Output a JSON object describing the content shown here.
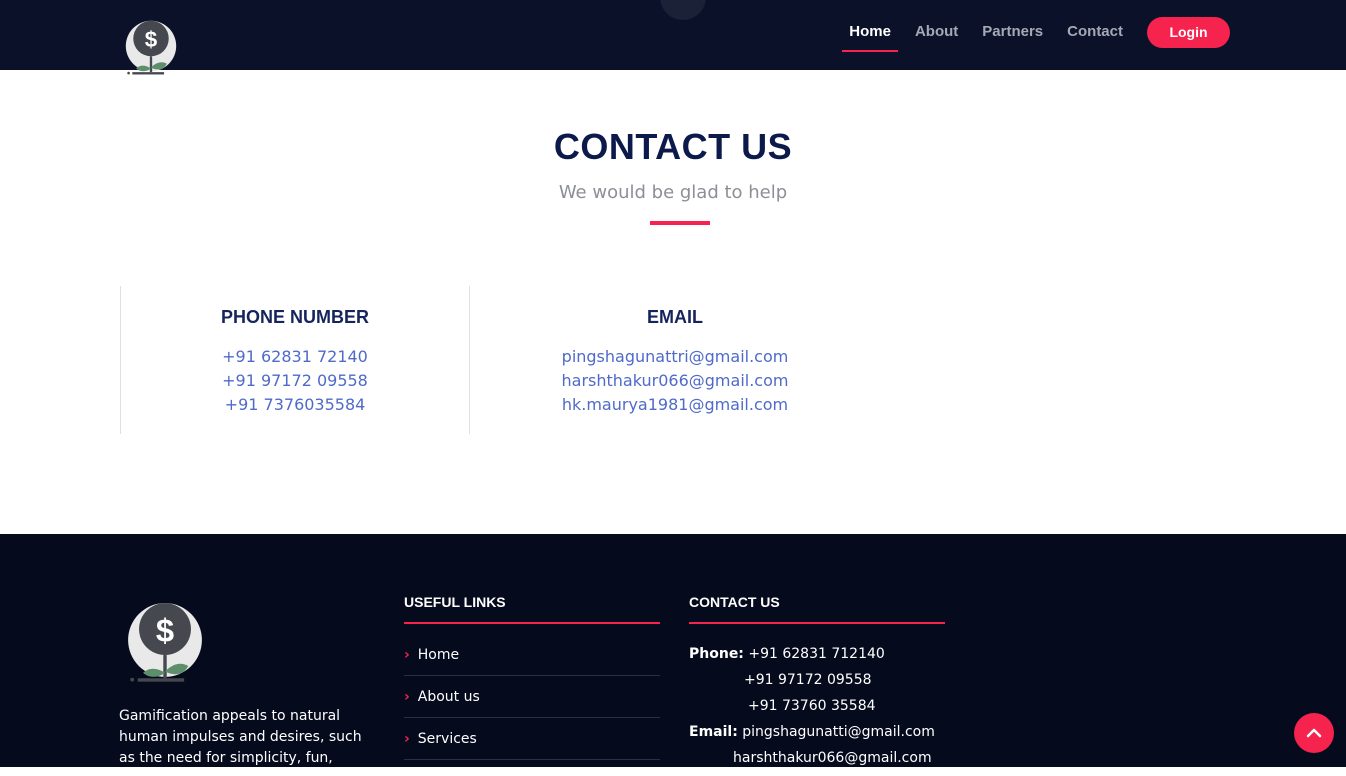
{
  "header": {
    "nav": [
      "Home",
      "About",
      "Partners",
      "Contact"
    ],
    "active_nav": "Home",
    "login_label": "Login"
  },
  "contact": {
    "title": "CONTACT US",
    "subtitle": "We would be glad to help",
    "phone": {
      "title": "PHONE NUMBER",
      "values": [
        "+91 62831 72140",
        "+91 97172 09558",
        "+91 7376035584"
      ]
    },
    "email": {
      "title": "EMAIL",
      "values": [
        "pingshagunattri@gmail.com",
        "harshthakur066@gmail.com",
        "hk.maurya1981@gmail.com"
      ]
    }
  },
  "footer": {
    "description": " Gamification appeals to natural human impulses and desires, such as the need for simplicity, fun,",
    "useful_links": {
      "title": "USEFUL LINKS",
      "items": [
        "Home",
        "About us",
        "Services"
      ]
    },
    "contact": {
      "title": "CONTACT US",
      "phone_label": "Phone:",
      "phones": [
        "+91 62831 712140",
        "+91 97172 09558",
        "+91 73760 35584"
      ],
      "email_label": "Email:",
      "emails": [
        "pingshagunatti@gmail.com",
        "harshthakur066@gmail.com"
      ]
    }
  },
  "colors": {
    "header_bg": "#0b1128",
    "footer_bg": "#050a1d",
    "accent": "#f5234d",
    "title": "#0b1a4a",
    "link": "#4f6ac9"
  },
  "icons": {
    "logo": "dollar-plant-logo",
    "scroll_top": "chevron-up-icon",
    "link_bullet": "chevron-right-icon"
  }
}
